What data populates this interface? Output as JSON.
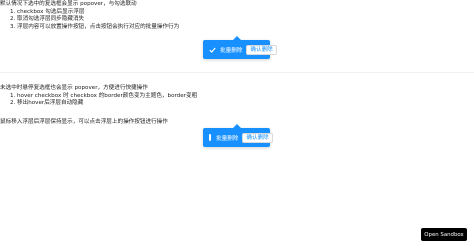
{
  "section1": {
    "description": "默认情况下选中的复选框会显示 popover，与勾选联动",
    "notes": [
      {
        "index": "1.",
        "text": "checkbox 勾选后显示浮层"
      },
      {
        "index": "2.",
        "text": "取消勾选浮层同步隐藏消失"
      },
      {
        "index": "3.",
        "text": "浮层内容可以放置操作按钮，点击按钮会执行对应的批量操作行为"
      }
    ]
  },
  "section2": {
    "description": "未选中时悬停复选框也会显示 popover，方便进行快捷操作",
    "notes": [
      {
        "index": "1.",
        "text": "hover checkbox 时 checkbox 的border颜色变为主题色，border变粗"
      },
      {
        "index": "2.",
        "text": "移出hover后浮层自动隐藏"
      }
    ],
    "after": "鼠标移入浮层后浮层保持显示，可以点击浮层上的操作按钮进行操作"
  },
  "popover1": {
    "label": "批量删除",
    "button": "确认删除"
  },
  "popover2": {
    "label": "批量删除",
    "button": "确认删除"
  },
  "sandbox_button": "Open Sandbox",
  "colors": {
    "primary": "#1890ff",
    "sandbox": "#000000"
  }
}
